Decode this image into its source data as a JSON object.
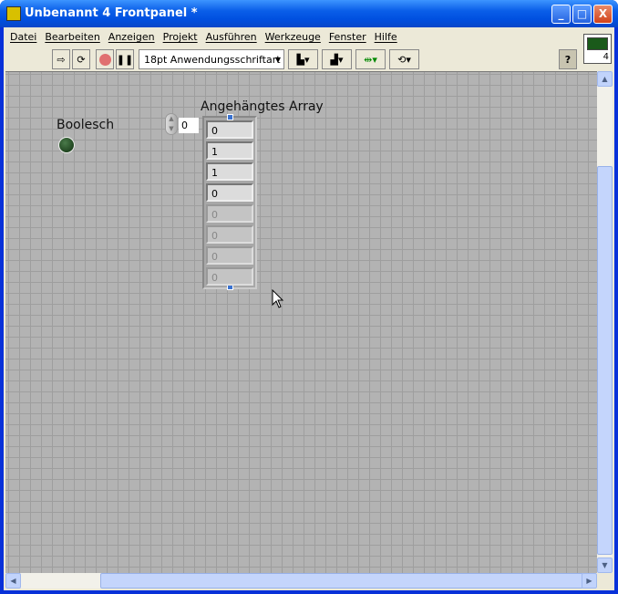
{
  "window": {
    "title": "Unbenannt 4 Frontpanel *",
    "minimize": "_",
    "maximize": "□",
    "close": "X"
  },
  "menu": [
    "Datei",
    "Bearbeiten",
    "Anzeigen",
    "Projekt",
    "Ausführen",
    "Werkzeuge",
    "Fenster",
    "Hilfe"
  ],
  "toolbar": {
    "font": "18pt Anwendungsschriftart",
    "help": "?",
    "connector_number": "4"
  },
  "panel": {
    "led": {
      "label": "Boolesch",
      "state": "off"
    },
    "array": {
      "label": "Angehängtes Array",
      "index": "0",
      "values": [
        "0",
        "1",
        "1",
        "0"
      ],
      "empty_values": [
        "0",
        "0",
        "0",
        "0"
      ]
    }
  }
}
